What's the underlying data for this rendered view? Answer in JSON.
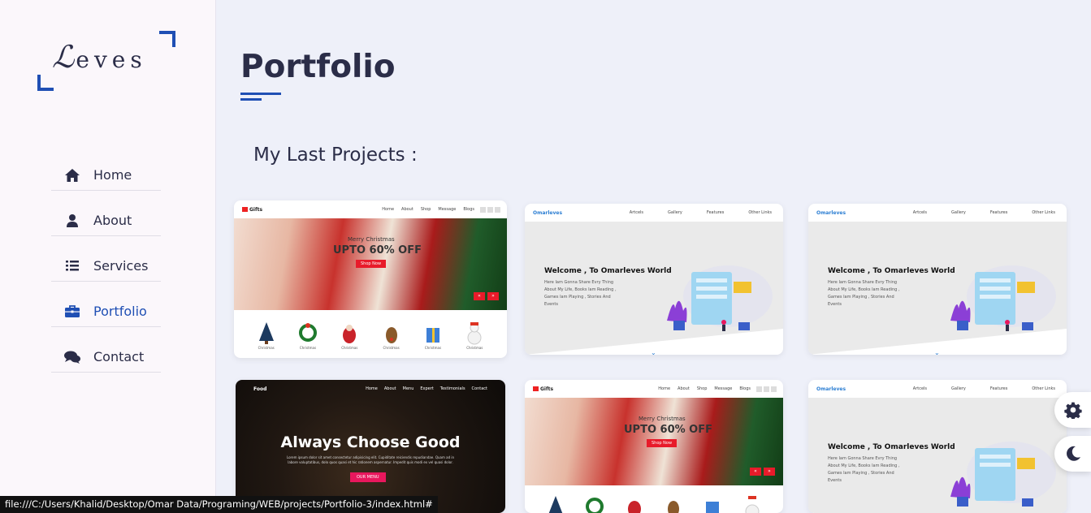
{
  "logo": {
    "text": "Leves"
  },
  "nav": {
    "items": [
      {
        "label": "Home",
        "icon": "home-icon"
      },
      {
        "label": "About",
        "icon": "user-icon"
      },
      {
        "label": "Services",
        "icon": "list-icon"
      },
      {
        "label": "Portfolio",
        "icon": "briefcase-icon",
        "active": true
      },
      {
        "label": "Contact",
        "icon": "chat-icon"
      }
    ]
  },
  "page": {
    "title": "Portfolio",
    "subtitle": "My Last Projects :"
  },
  "projects": {
    "gifts": {
      "brand": "Gifts",
      "nav": [
        "Home",
        "About",
        "Shop",
        "Message",
        "Blogs"
      ],
      "hero_small": "Merry Christmas",
      "hero_big": "UPTO 60% OFF",
      "button": "Shop Now",
      "prev": "«",
      "next": "»",
      "item_label": "Christmas"
    },
    "blog": {
      "brand": "Omarleves",
      "nav": [
        "Artcels",
        "Gallery",
        "Features",
        "Other Links"
      ],
      "heading": "Welcome , To Omarleves World",
      "text": "Here Iam Gonna Share Evry Thing About My Life, Books Iam Reading , Games Iam Playing , Stories And Events",
      "chevron": "⌄"
    },
    "food": {
      "brand": "Food",
      "nav": [
        "Home",
        "About",
        "Menu",
        "Expert",
        "Testimonials",
        "Contact"
      ],
      "heading": "Always Choose Good",
      "text": "Lorem ipsum dolor sit amet consectetur adipisicing elit. Cupiditate reiciendis repudiandae. Quam ad in labore voluptatibus, dolo quos quasi et hic rationem aspernatur. Impedit quis modi ex vel quasi dolor.",
      "button": "OUR MENU"
    }
  },
  "status_bar": {
    "url": "file:///C:/Users/Khalid/Desktop/Omar Data/Programing/WEB/projects/Portfolio-3/index.html#"
  },
  "colors": {
    "accent": "#1f4fb4",
    "text": "#2b2d48",
    "background": "#eef0f9",
    "sidebar": "#fbf7fb"
  }
}
